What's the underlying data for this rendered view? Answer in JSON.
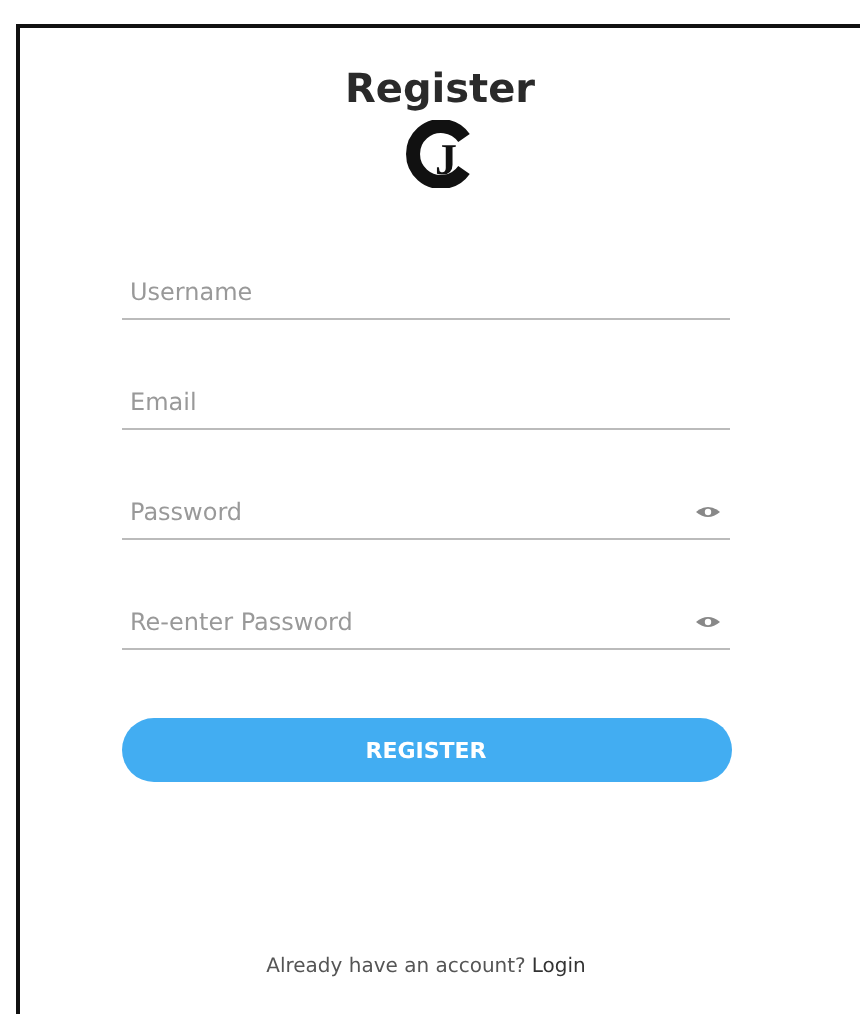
{
  "title": "Register",
  "logo": {
    "letter": "J"
  },
  "fields": [
    {
      "placeholder": "Username",
      "kind": "text"
    },
    {
      "placeholder": "Email",
      "kind": "text"
    },
    {
      "placeholder": "Password",
      "kind": "password"
    },
    {
      "placeholder": "Re-enter Password",
      "kind": "password"
    }
  ],
  "button": "REGISTER",
  "footer": {
    "text": "Already have an account?",
    "link": "Login"
  }
}
